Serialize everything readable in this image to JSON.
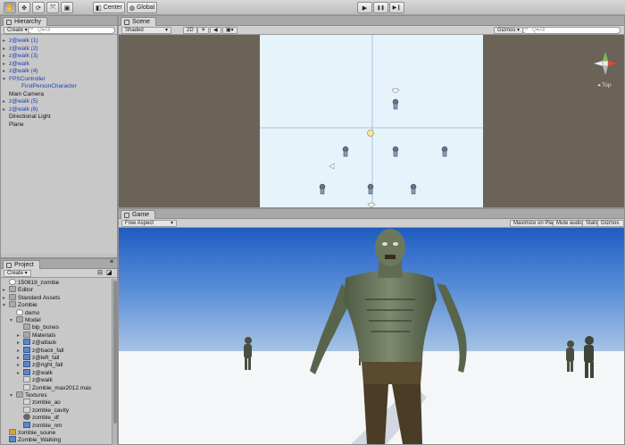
{
  "toolbar": {
    "tools": [
      "hand-tool",
      "move-tool",
      "rotate-tool",
      "scale-tool",
      "rect-tool"
    ],
    "pivot_label": "Center",
    "space_label": "Global",
    "play": "▶",
    "pause": "❚❚",
    "step": "▶❙"
  },
  "hierarchy": {
    "tab": "Hierarchy",
    "create": "Create ▾",
    "search_placeholder": "Q▾All",
    "items": [
      {
        "label": "z@walk (1)",
        "blue": true,
        "arrow": "▸",
        "indent": 0
      },
      {
        "label": "z@walk (2)",
        "blue": true,
        "arrow": "▸",
        "indent": 0
      },
      {
        "label": "z@walk (3)",
        "blue": true,
        "arrow": "▸",
        "indent": 0
      },
      {
        "label": "z@walk",
        "blue": true,
        "arrow": "▸",
        "indent": 0
      },
      {
        "label": "z@walk (4)",
        "blue": true,
        "arrow": "▸",
        "indent": 0
      },
      {
        "label": "FPSController",
        "blue": true,
        "arrow": "▾",
        "indent": 0
      },
      {
        "label": "FirstPersonCharacter",
        "blue": true,
        "arrow": "",
        "indent": 1
      },
      {
        "label": "Main Camera",
        "blue": false,
        "arrow": "",
        "indent": 0
      },
      {
        "label": "z@walk (5)",
        "blue": true,
        "arrow": "▸",
        "indent": 0
      },
      {
        "label": "z@walk (6)",
        "blue": true,
        "arrow": "▸",
        "indent": 0
      },
      {
        "label": "Directional Light",
        "blue": false,
        "arrow": "",
        "indent": 0
      },
      {
        "label": "Plane",
        "blue": false,
        "arrow": "",
        "indent": 0
      }
    ]
  },
  "scene": {
    "tab": "Scene",
    "shading": "Shaded",
    "mode2d": "2D",
    "gizmos": "Gizmos ▾",
    "search_placeholder": "Q▾All",
    "view_label": "◂ Top"
  },
  "game": {
    "tab": "Game",
    "aspect": "Free Aspect",
    "maximize": "Maximize on Play",
    "mute": "Mute audio",
    "stats": "Stats",
    "gizmos": "Gizmos ▾"
  },
  "project": {
    "tab": "Project",
    "create": "Create ▾",
    "items": [
      {
        "label": "150819_zombie",
        "icon": "unity",
        "arrow": "",
        "indent": 0
      },
      {
        "label": "Editor",
        "icon": "folder",
        "arrow": "▸",
        "indent": 0
      },
      {
        "label": "Standard Assets",
        "icon": "folder",
        "arrow": "▸",
        "indent": 0
      },
      {
        "label": "Zombie",
        "icon": "folder",
        "arrow": "▾",
        "indent": 0
      },
      {
        "label": "demo",
        "icon": "unity",
        "arrow": "",
        "indent": 1
      },
      {
        "label": "Model",
        "icon": "folder",
        "arrow": "▾",
        "indent": 1
      },
      {
        "label": "bip_bones",
        "icon": "folder",
        "arrow": "",
        "indent": 2
      },
      {
        "label": "Materials",
        "icon": "folder",
        "arrow": "▸",
        "indent": 2
      },
      {
        "label": "z@attack",
        "icon": "model",
        "arrow": "▸",
        "indent": 2
      },
      {
        "label": "z@back_fall",
        "icon": "model",
        "arrow": "▸",
        "indent": 2
      },
      {
        "label": "z@left_fall",
        "icon": "model",
        "arrow": "▸",
        "indent": 2
      },
      {
        "label": "z@right_fall",
        "icon": "model",
        "arrow": "▸",
        "indent": 2
      },
      {
        "label": "z@walk",
        "icon": "model",
        "arrow": "▸",
        "indent": 2
      },
      {
        "label": "z@walk",
        "icon": "tex",
        "arrow": "",
        "indent": 2
      },
      {
        "label": "Zombie_max2012.max",
        "icon": "tex",
        "arrow": "",
        "indent": 2
      },
      {
        "label": "Textures",
        "icon": "folder",
        "arrow": "▾",
        "indent": 1
      },
      {
        "label": "zombie_ao",
        "icon": "tex",
        "arrow": "",
        "indent": 2
      },
      {
        "label": "zombie_cavity",
        "icon": "tex",
        "arrow": "",
        "indent": 2
      },
      {
        "label": "zombie_df",
        "icon": "mat",
        "arrow": "",
        "indent": 2
      },
      {
        "label": "zombie_nm",
        "icon": "matblue",
        "arrow": "",
        "indent": 2
      },
      {
        "label": "zombie_soune",
        "icon": "audio",
        "arrow": "",
        "indent": 0
      },
      {
        "label": "Zombie_Walking",
        "icon": "anim",
        "arrow": "",
        "indent": 0
      }
    ]
  }
}
